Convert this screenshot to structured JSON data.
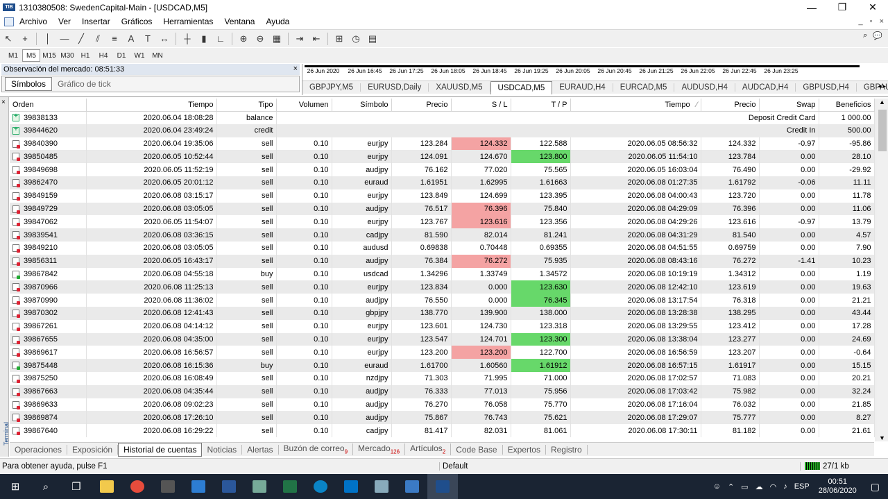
{
  "window": {
    "title": "1310380508: SwedenCapital-Main - [USDCAD,M5]",
    "badge": "TIB"
  },
  "menu": [
    "Archivo",
    "Ver",
    "Insertar",
    "Gráficos",
    "Herramientas",
    "Ventana",
    "Ayuda"
  ],
  "timeframes": [
    "M1",
    "M5",
    "M15",
    "M30",
    "H1",
    "H4",
    "D1",
    "W1",
    "MN"
  ],
  "market_watch": {
    "title": "Observación del mercado: 08:51:33",
    "tabs": [
      "Símbolos",
      "Gráfico de tick"
    ]
  },
  "chart": {
    "times": [
      "26 Jun 2020",
      "26 Jun 16:45",
      "26 Jun 17:25",
      "26 Jun 18:05",
      "26 Jun 18:45",
      "26 Jun 19:25",
      "26 Jun 20:05",
      "26 Jun 20:45",
      "26 Jun 21:25",
      "26 Jun 22:05",
      "26 Jun 22:45",
      "26 Jun 23:25"
    ],
    "tabs": [
      "GBPJPY,M5",
      "EURUSD,Daily",
      "XAUUSD,M5",
      "USDCAD,M5",
      "EURAUD,H4",
      "EURCAD,M5",
      "AUDUSD,H4",
      "AUDCAD,H4",
      "GBPUSD,H4",
      "GBPAUD,H"
    ]
  },
  "table": {
    "headers": [
      "Orden",
      "Tiempo",
      "Tipo",
      "Volumen",
      "Símbolo",
      "Precio",
      "S / L",
      "T / P",
      "Tiempo",
      "Precio",
      "Swap",
      "Beneficios"
    ],
    "sort_indicator": "⁄",
    "credit_rows": [
      {
        "order": "39838133",
        "time": "2020.06.04 18:08:28",
        "type": "balance",
        "comment": "Deposit Credit Card",
        "profit": "1 000.00"
      },
      {
        "order": "39844620",
        "time": "2020.06.04 23:49:24",
        "type": "credit",
        "comment": "Credit In",
        "profit": "500.00"
      }
    ],
    "rows": [
      [
        "39840390",
        "2020.06.04 19:35:06",
        "sell",
        "0.10",
        "eurjpy",
        "123.284",
        "124.332",
        "122.588",
        "2020.06.05 08:56:32",
        "124.332",
        "-0.97",
        "-95.86",
        "sl"
      ],
      [
        "39850485",
        "2020.06.05 10:52:44",
        "sell",
        "0.10",
        "eurjpy",
        "124.091",
        "124.670",
        "123.800",
        "2020.06.05 11:54:10",
        "123.784",
        "0.00",
        "28.10",
        "tp"
      ],
      [
        "39849698",
        "2020.06.05 11:52:19",
        "sell",
        "0.10",
        "audjpy",
        "76.162",
        "77.020",
        "75.565",
        "2020.06.05 16:03:04",
        "76.490",
        "0.00",
        "-29.92",
        ""
      ],
      [
        "39862470",
        "2020.06.05 20:01:12",
        "sell",
        "0.10",
        "euraud",
        "1.61951",
        "1.62995",
        "1.61663",
        "2020.06.08 01:27:35",
        "1.61792",
        "-0.06",
        "11.11",
        ""
      ],
      [
        "39849159",
        "2020.06.08 03:15:17",
        "sell",
        "0.10",
        "eurjpy",
        "123.849",
        "124.699",
        "123.395",
        "2020.06.08 04:00:43",
        "123.720",
        "0.00",
        "11.78",
        ""
      ],
      [
        "39849729",
        "2020.06.08 03:05:05",
        "sell",
        "0.10",
        "audjpy",
        "76.517",
        "76.396",
        "75.840",
        "2020.06.08 04:29:09",
        "76.396",
        "0.00",
        "11.06",
        "sl"
      ],
      [
        "39847062",
        "2020.06.05 11:54:07",
        "sell",
        "0.10",
        "eurjpy",
        "123.767",
        "123.616",
        "123.356",
        "2020.06.08 04:29:26",
        "123.616",
        "-0.97",
        "13.79",
        "sl"
      ],
      [
        "39839541",
        "2020.06.08 03:36:15",
        "sell",
        "0.10",
        "cadjpy",
        "81.590",
        "82.014",
        "81.241",
        "2020.06.08 04:31:29",
        "81.540",
        "0.00",
        "4.57",
        ""
      ],
      [
        "39849210",
        "2020.06.08 03:05:05",
        "sell",
        "0.10",
        "audusd",
        "0.69838",
        "0.70448",
        "0.69355",
        "2020.06.08 04:51:55",
        "0.69759",
        "0.00",
        "7.90",
        ""
      ],
      [
        "39856311",
        "2020.06.05 16:43:17",
        "sell",
        "0.10",
        "audjpy",
        "76.384",
        "76.272",
        "75.935",
        "2020.06.08 08:43:16",
        "76.272",
        "-1.41",
        "10.23",
        "sl"
      ],
      [
        "39867842",
        "2020.06.08 04:55:18",
        "buy",
        "0.10",
        "usdcad",
        "1.34296",
        "1.33749",
        "1.34572",
        "2020.06.08 10:19:19",
        "1.34312",
        "0.00",
        "1.19",
        ""
      ],
      [
        "39870966",
        "2020.06.08 11:25:13",
        "sell",
        "0.10",
        "eurjpy",
        "123.834",
        "0.000",
        "123.630",
        "2020.06.08 12:42:10",
        "123.619",
        "0.00",
        "19.63",
        "tp"
      ],
      [
        "39870990",
        "2020.06.08 11:36:02",
        "sell",
        "0.10",
        "audjpy",
        "76.550",
        "0.000",
        "76.345",
        "2020.06.08 13:17:54",
        "76.318",
        "0.00",
        "21.21",
        "tp"
      ],
      [
        "39870302",
        "2020.06.08 12:41:43",
        "sell",
        "0.10",
        "gbpjpy",
        "138.770",
        "139.900",
        "138.000",
        "2020.06.08 13:28:38",
        "138.295",
        "0.00",
        "43.44",
        ""
      ],
      [
        "39867261",
        "2020.06.08 04:14:12",
        "sell",
        "0.10",
        "eurjpy",
        "123.601",
        "124.730",
        "123.318",
        "2020.06.08 13:29:55",
        "123.412",
        "0.00",
        "17.28",
        ""
      ],
      [
        "39867655",
        "2020.06.08 04:35:00",
        "sell",
        "0.10",
        "eurjpy",
        "123.547",
        "124.701",
        "123.300",
        "2020.06.08 13:38:04",
        "123.277",
        "0.00",
        "24.69",
        "tp"
      ],
      [
        "39869617",
        "2020.06.08 16:56:57",
        "sell",
        "0.10",
        "eurjpy",
        "123.200",
        "123.200",
        "122.700",
        "2020.06.08 16:56:59",
        "123.207",
        "0.00",
        "-0.64",
        "sl"
      ],
      [
        "39875448",
        "2020.06.08 16:15:36",
        "buy",
        "0.10",
        "euraud",
        "1.61700",
        "1.60560",
        "1.61912",
        "2020.06.08 16:57:15",
        "1.61917",
        "0.00",
        "15.15",
        "tp"
      ],
      [
        "39875250",
        "2020.06.08 16:08:49",
        "sell",
        "0.10",
        "nzdjpy",
        "71.303",
        "71.995",
        "71.000",
        "2020.06.08 17:02:57",
        "71.083",
        "0.00",
        "20.21",
        ""
      ],
      [
        "39867663",
        "2020.06.08 04:35:44",
        "sell",
        "0.10",
        "audjpy",
        "76.333",
        "77.013",
        "75.956",
        "2020.06.08 17:03:42",
        "75.982",
        "0.00",
        "32.24",
        ""
      ],
      [
        "39869633",
        "2020.06.08 09:02:23",
        "sell",
        "0.10",
        "audjpy",
        "76.270",
        "76.058",
        "75.770",
        "2020.06.08 17:16:04",
        "76.032",
        "0.00",
        "21.85",
        ""
      ],
      [
        "39869874",
        "2020.06.08 17:26:10",
        "sell",
        "0.10",
        "audjpy",
        "75.867",
        "76.743",
        "75.621",
        "2020.06.08 17:29:07",
        "75.777",
        "0.00",
        "8.27",
        ""
      ],
      [
        "39867640",
        "2020.06.08 16:29:22",
        "sell",
        "0.10",
        "cadjpy",
        "81.417",
        "82.031",
        "81.061",
        "2020.06.08 17:30:11",
        "81.182",
        "0.00",
        "21.61",
        ""
      ]
    ]
  },
  "terminal_tabs": [
    {
      "label": "Operaciones"
    },
    {
      "label": "Exposición"
    },
    {
      "label": "Historial de cuentas",
      "active": true
    },
    {
      "label": "Noticias"
    },
    {
      "label": "Alertas"
    },
    {
      "label": "Buzón de correo",
      "badge": "9"
    },
    {
      "label": "Mercado",
      "badge": "126"
    },
    {
      "label": "Artículos",
      "badge": "2"
    },
    {
      "label": "Code Base"
    },
    {
      "label": "Expertos"
    },
    {
      "label": "Registro"
    }
  ],
  "terminal_label": "Terminal",
  "status": {
    "help": "Para obtener ayuda, pulse F1",
    "profile": "Default",
    "traffic": "27/1 kb"
  },
  "taskbar": {
    "lang": "ESP",
    "time": "00:51",
    "date": "28/06/2020"
  },
  "colors": {
    "sl_hit": "#f4a3a3",
    "tp_hit": "#67d86a"
  }
}
